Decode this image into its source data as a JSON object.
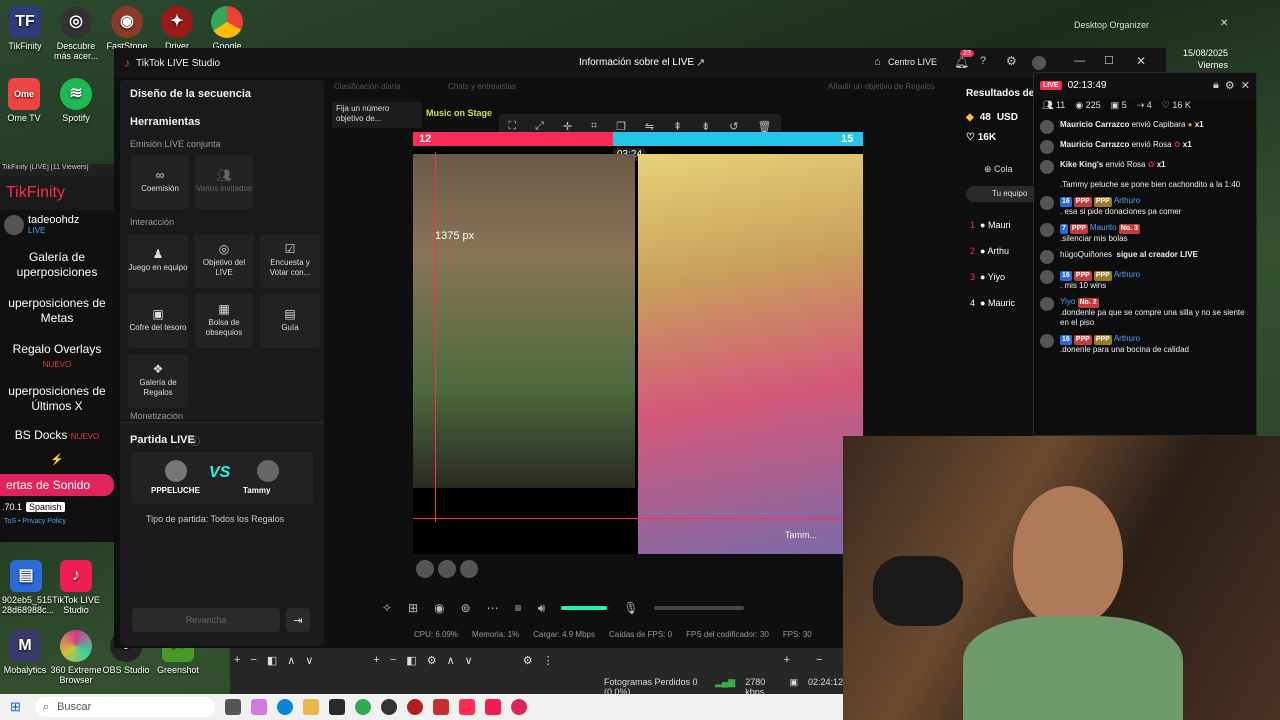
{
  "desktop": {
    "organizer_label": "Desktop Organizer",
    "date": "15/08/2025",
    "weekday": "Viernes",
    "icons": [
      {
        "label": "TikFinity",
        "icon": "tikfinity-icon",
        "color": "#2f3b7a"
      },
      {
        "label": "Descubre más acer...",
        "icon": "compass-icon",
        "color": "#333"
      },
      {
        "label": "FastStone Im...",
        "icon": "eye-icon",
        "color": "#8a3a2a"
      },
      {
        "label": "Driver",
        "icon": "driver-icon",
        "color": "#9a1a1a"
      },
      {
        "label": "Google",
        "icon": "chrome-icon",
        "color": "#2a7a3a"
      }
    ],
    "bottom_icons": [
      {
        "label": "902eb5_515 28d68988c...",
        "icon": "file-icon",
        "color": "#2a6bd8"
      },
      {
        "label": "TikTok LIVE Studio",
        "icon": "tiktok-icon",
        "color": "#ee1d52"
      },
      {
        "label": "Mobalytics",
        "icon": "mobalytics-icon",
        "color": "#3a3a6a"
      },
      {
        "label": "360 Extreme Browser",
        "icon": "browser-icon",
        "color": "#d03a8a"
      },
      {
        "label": "OBS Studio",
        "icon": "obs-icon",
        "color": "#222"
      },
      {
        "label": "Greenshot",
        "icon": "greenshot-icon",
        "color": "#4a9a2a"
      }
    ],
    "ome_label": "Ome TV",
    "spotify_label": "Spotify"
  },
  "tikfinity": {
    "window_title": "TikFinity [LIVE] [11 Viewers]",
    "brand": "TikFinity",
    "user": "tadeoohdz",
    "user_status": "LIVE",
    "menu": [
      {
        "label": "Galería de uperposiciones",
        "sub": ""
      },
      {
        "label": "uperposiciones de Metas",
        "sub": ""
      },
      {
        "label": "Regalo Overlays",
        "sub": "NUEVO"
      },
      {
        "label": "uperposiciones de Últimos X",
        "sub": ""
      },
      {
        "label": "BS Docks",
        "sub": "NUEVO"
      }
    ],
    "sound_button": "ertas de Sonido",
    "version": ".70.1",
    "language": "Spanish",
    "legal": "ToS • Privacy Policy"
  },
  "studio": {
    "app_title": "TikTok LIVE Studio",
    "center_title": "Información sobre el LIVE",
    "centro_live": "Centro LIVE",
    "notif_count": "23",
    "left": {
      "sequence": "Diseño de la secuencia",
      "tools": "Herramientas",
      "joint": "Emisión LIVE conjunta",
      "tiles_joint": [
        {
          "label": "Coemisión",
          "icon": "link-icon",
          "dim": false
        },
        {
          "label": "Varios invitados",
          "icon": "users-icon",
          "dim": true
        }
      ],
      "interaction": "Interacción",
      "tiles_inter": [
        {
          "label": "Juego en equipo",
          "icon": "joystick-icon"
        },
        {
          "label": "Objetivo del LIVE",
          "icon": "target-icon"
        },
        {
          "label": "Encuesta y Votar con...",
          "icon": "poll-icon"
        },
        {
          "label": "Cofre del tesoro",
          "icon": "chest-icon"
        },
        {
          "label": "Bolsa de obsequios",
          "icon": "bag-icon"
        },
        {
          "label": "Guía",
          "icon": "guide-icon"
        },
        {
          "label": "Galería de Regalos",
          "icon": "gift-icon"
        }
      ],
      "monetization": "Monetización",
      "match_title": "Partida LIVE",
      "player1": "PPPELUCHE",
      "player2": "Tammy",
      "vs": "VS",
      "match_type": "Tipo de partida: Todos los Regalos",
      "rematch": "Revancha"
    },
    "tabs": [
      "Clasificación diaria",
      "Chats y entrevistas"
    ],
    "goal_tab": "Añadir un objetivo de Regalos",
    "pin_label": "Fija un número objetivo de...",
    "music_label": "Music on Stage",
    "battle": {
      "left_score": "12",
      "right_score": "15",
      "timer": "03:24",
      "px_label": "1375 px",
      "right_name": "Tamm..."
    },
    "status": {
      "cpu": "CPU: 6.09%",
      "mem": "Memoria: 1%",
      "load": "Cargar: 4.9 Mbps",
      "fps_drop": "Caídas de FPS: 0",
      "enc_fps": "FPS del codificador: 30",
      "fps": "FPS: 30"
    },
    "results_title": "Resultados del",
    "results_stats": {
      "coins": "48",
      "usd": "USD",
      "k": "16K"
    },
    "collab": "Cola",
    "team_tab": "Tu equipo",
    "ranking": [
      {
        "rank": "1",
        "name": "Mauri"
      },
      {
        "rank": "2",
        "name": "Arthu"
      },
      {
        "rank": "3",
        "name": "Yiyo"
      },
      {
        "rank": "4",
        "name": "Mauric"
      }
    ]
  },
  "chat": {
    "live_badge": "LIVE",
    "time": "02:13:49",
    "stats": {
      "viewers": "11",
      "views": "225",
      "gifts": "5",
      "shares": "4",
      "likes": "16 K"
    },
    "messages": [
      {
        "user": "Mauricio Carrazco",
        "text": "envió Capibara",
        "extra": "x1",
        "badges": []
      },
      {
        "user": "Mauricio Carrazco",
        "text": "envió Rosa",
        "extra": "x1",
        "badges": []
      },
      {
        "user": "Kike King's",
        "text": "envió Rosa",
        "extra": "x1",
        "badges": []
      },
      {
        "user": "",
        "text": ".Tammy peluche se pone bien cachondito a la 1:40",
        "extra": "",
        "badges": []
      },
      {
        "user": "Arthuro",
        "text": ". esa si pide donaciones pa comer",
        "extra": "",
        "badges": [
          "16",
          "PPP",
          "PPP"
        ]
      },
      {
        "user": "Maurito",
        "text": ".silenciar mis bolas",
        "extra": "",
        "badges": [
          "7",
          "PPP",
          "No. 3"
        ]
      },
      {
        "user": "hügoQuiñones",
        "text": "sigue al creador LIVE",
        "extra": "",
        "badges": []
      },
      {
        "user": "Arthuro",
        "text": ". mis 10 wins",
        "extra": "",
        "badges": [
          "16",
          "PPP",
          "PPP"
        ]
      },
      {
        "user": "Yiyo",
        "text": ".dondenle pa que se compre una silla y no se siente en el piso",
        "extra": "",
        "badges": [
          "No. 2"
        ]
      },
      {
        "user": "Arthuro",
        "text": ".donenle para una bocina de calidad",
        "extra": "",
        "badges": [
          "16",
          "PPP",
          "PPP"
        ]
      }
    ]
  },
  "obs": {
    "lost_frames": "Fotogramas Perdidos 0 (0.0%)",
    "bitrate": "2780 kbps",
    "time": "02:24:12"
  },
  "taskbar": {
    "search_placeholder": "Buscar"
  },
  "colors": {
    "accent": "#fe2c55",
    "cyan": "#25f4ee",
    "music": "#c8e34a"
  }
}
